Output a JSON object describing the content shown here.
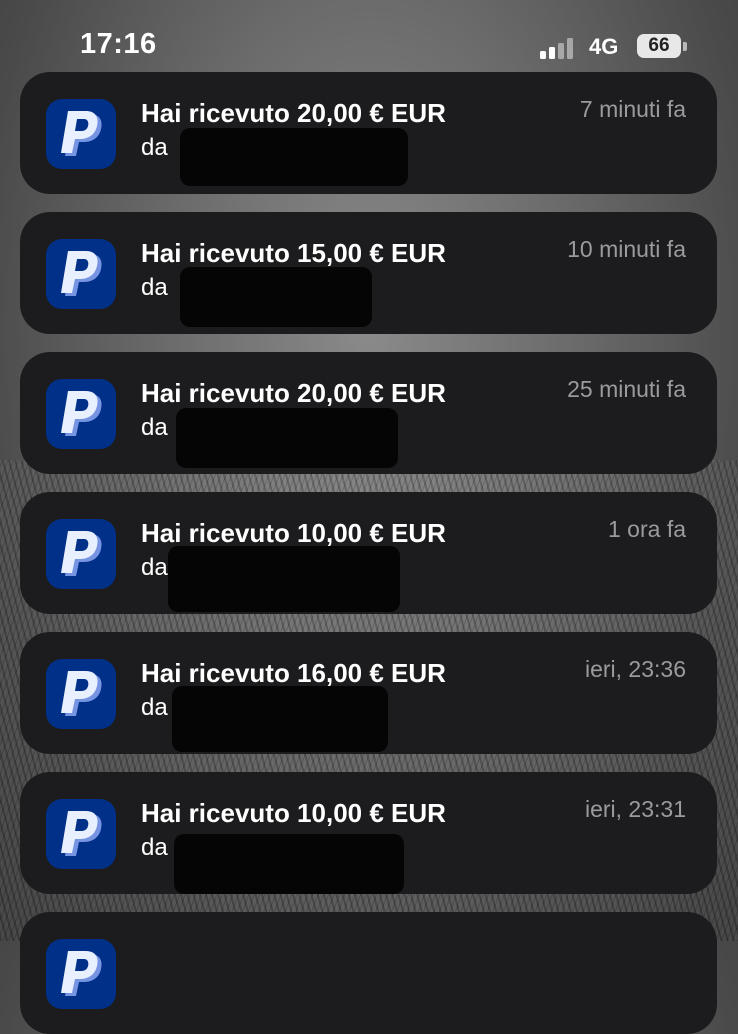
{
  "status_bar": {
    "time": "17:16",
    "network": "4G",
    "battery": "66",
    "signal_bars_active": 2,
    "signal_bars_total": 4
  },
  "colors": {
    "card": "#1c1c1e",
    "paypal_blue": "#003087",
    "paypal_light": "#e8efff",
    "time_gray": "#9b9b9f"
  },
  "notifications": [
    {
      "app_icon": "paypal-icon",
      "title": "Hai ricevuto 20,00 € EUR",
      "body": "da",
      "time": "7 minuti fa"
    },
    {
      "app_icon": "paypal-icon",
      "title": "Hai ricevuto 15,00 € EUR",
      "body": "da",
      "time": "10 minuti fa"
    },
    {
      "app_icon": "paypal-icon",
      "title": "Hai ricevuto 20,00 € EUR",
      "body": "da",
      "time": "25 minuti fa"
    },
    {
      "app_icon": "paypal-icon",
      "title": "Hai ricevuto 10,00 € EUR",
      "body": "da",
      "time": "1 ora fa"
    },
    {
      "app_icon": "paypal-icon",
      "title": "Hai ricevuto 16,00 € EUR",
      "body": "da",
      "time": "ieri, 23:36"
    },
    {
      "app_icon": "paypal-icon",
      "title": "Hai ricevuto 10,00 € EUR",
      "body": "da",
      "time": "ieri, 23:31"
    },
    {
      "app_icon": "paypal-icon"
    }
  ]
}
